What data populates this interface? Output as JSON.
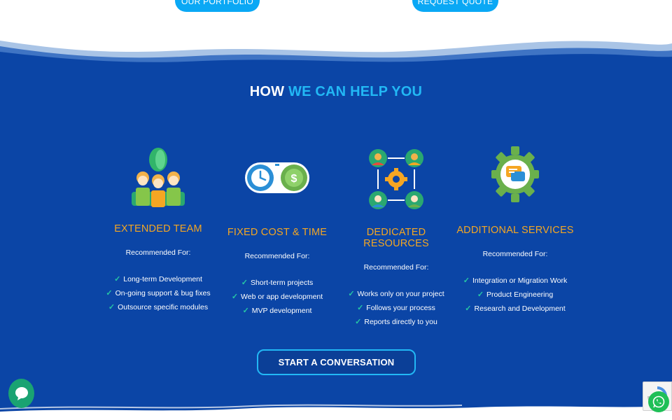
{
  "top_buttons": {
    "portfolio_label": "OUR PORTFOLIO",
    "quote_label": "REQUEST QUOTE"
  },
  "section": {
    "heading_part1": "HOW ",
    "heading_part2": "WE CAN HELP YOU"
  },
  "cards": [
    {
      "title": "EXTENDED TEAM",
      "recommended": "Recommended For:",
      "items": [
        "Long-term Development",
        "On-going support & bug fixes",
        "Outsource specific modules"
      ],
      "icon": "team-icon"
    },
    {
      "title": "FIXED COST & TIME",
      "recommended": "Recommended For:",
      "items": [
        "Short-term projects",
        "Web or app development",
        "MVP development"
      ],
      "icon": "clock-dollar-icon"
    },
    {
      "title": "DEDICATED RESOURCES",
      "recommended": "Recommended For:",
      "items": [
        "Works only on your project",
        "Follows your process",
        "Reports directly to you"
      ],
      "icon": "network-people-icon"
    },
    {
      "title": "ADDITIONAL SERVICES",
      "recommended": "Recommended For:",
      "items": [
        "Integration or Migration Work",
        "Product Engineering",
        "Research and Development"
      ],
      "icon": "gear-chat-icon"
    }
  ],
  "cta": {
    "label": "START A CONVERSATION"
  },
  "colors": {
    "background": "#0b45a6",
    "accent_blue": "#22b8f5",
    "title_orange": "#f3a623",
    "check_green": "#26c7a4"
  }
}
